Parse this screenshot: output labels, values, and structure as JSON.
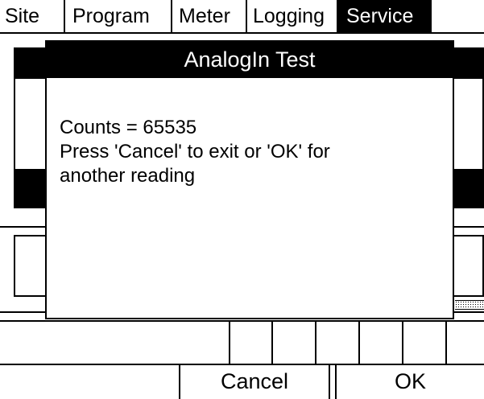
{
  "menu": {
    "items": [
      {
        "label": "Site",
        "active": false
      },
      {
        "label": "Program",
        "active": false
      },
      {
        "label": "Meter",
        "active": false
      },
      {
        "label": "Logging",
        "active": false
      },
      {
        "label": "Service",
        "active": true
      }
    ]
  },
  "dialog": {
    "title": "AnalogIn Test",
    "counts_line": "Counts = 65535",
    "instruction_line1": "Press 'Cancel' to exit or 'OK' for",
    "instruction_line2": "another reading"
  },
  "softkeys": {
    "cancel": "Cancel",
    "ok": "OK"
  },
  "colors": {
    "foreground": "#000000",
    "background": "#ffffff"
  }
}
